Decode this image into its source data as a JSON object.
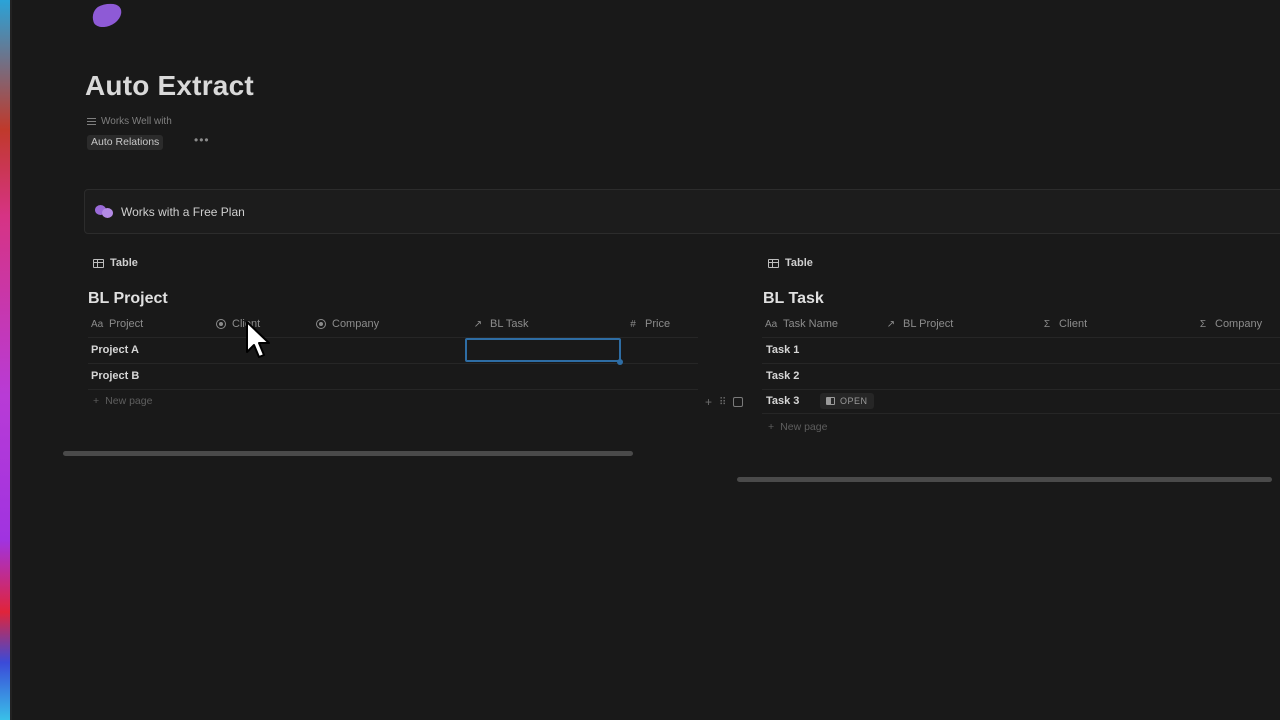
{
  "page": {
    "title": "Auto Extract",
    "property_label": "Works Well with",
    "property_tag": "Auto Relations",
    "more_label": "•••"
  },
  "callout": {
    "text": "Works with a Free Plan"
  },
  "left_db": {
    "view_label": "Table",
    "title": "BL Project",
    "columns": [
      {
        "icon": "Aa",
        "label": "Project"
      },
      {
        "icon": "circle",
        "label": "Client"
      },
      {
        "icon": "circle",
        "label": "Company"
      },
      {
        "icon": "↗",
        "label": "BL Task"
      },
      {
        "icon": "#",
        "label": "Price"
      }
    ],
    "rows": [
      "Project A",
      "Project B"
    ],
    "new_page": "New page"
  },
  "right_db": {
    "view_label": "Table",
    "title": "BL Task",
    "columns": [
      {
        "icon": "Aa",
        "label": "Task Name"
      },
      {
        "icon": "↗",
        "label": "BL Project"
      },
      {
        "icon": "Σ",
        "label": "Client"
      },
      {
        "icon": "Σ",
        "label": "Company"
      }
    ],
    "rows": [
      "Task 1",
      "Task 2",
      "Task 3"
    ],
    "open_label": "OPEN",
    "new_page": "New page"
  },
  "icons": {
    "plus": "+",
    "drag": "⠿"
  },
  "colors": {
    "background": "#191919",
    "accent_purple": "#8e5ad6",
    "selection_blue": "#2e6da4"
  }
}
